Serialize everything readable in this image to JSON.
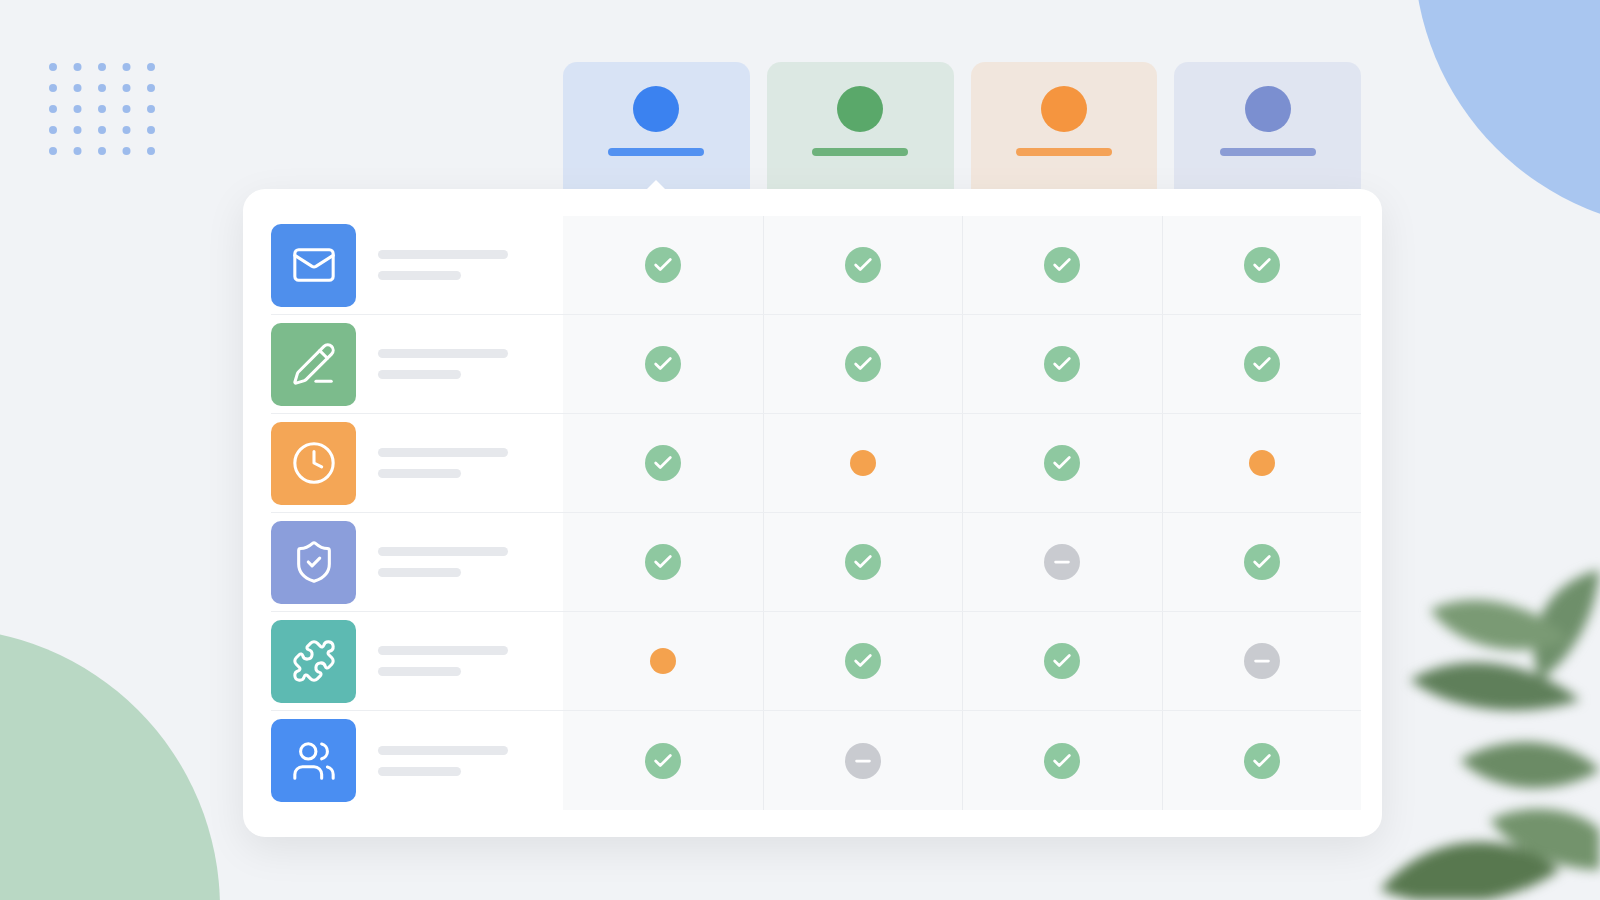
{
  "columns": [
    {
      "color": "#3b82f0",
      "selected": true
    },
    {
      "color": "#5aa86a",
      "selected": false
    },
    {
      "color": "#f5953f",
      "selected": false
    },
    {
      "color": "#7b8fd0",
      "selected": false
    }
  ],
  "rows": [
    {
      "color": "#4f8fec",
      "cells": [
        {
          "kind": "check"
        },
        {
          "kind": "check"
        },
        {
          "kind": "check"
        },
        {
          "kind": "check"
        }
      ]
    },
    {
      "color": "#7cbb8c",
      "cells": [
        {
          "kind": "check"
        },
        {
          "kind": "check"
        },
        {
          "kind": "check"
        },
        {
          "kind": "check"
        }
      ]
    },
    {
      "color": "#f4a656",
      "cells": [
        {
          "kind": "check"
        },
        {
          "kind": "partial"
        },
        {
          "kind": "check"
        },
        {
          "kind": "partial"
        }
      ]
    },
    {
      "color": "#8b9edb",
      "cells": [
        {
          "kind": "check"
        },
        {
          "kind": "check"
        },
        {
          "kind": "none"
        },
        {
          "kind": "check"
        }
      ]
    },
    {
      "color": "#5dbab2",
      "cells": [
        {
          "kind": "partial"
        },
        {
          "kind": "check"
        },
        {
          "kind": "check"
        },
        {
          "kind": "none"
        }
      ]
    },
    {
      "color": "#4a8ef2",
      "cells": [
        {
          "kind": "check"
        },
        {
          "kind": "none"
        },
        {
          "kind": "check"
        },
        {
          "kind": "check"
        }
      ]
    }
  ]
}
